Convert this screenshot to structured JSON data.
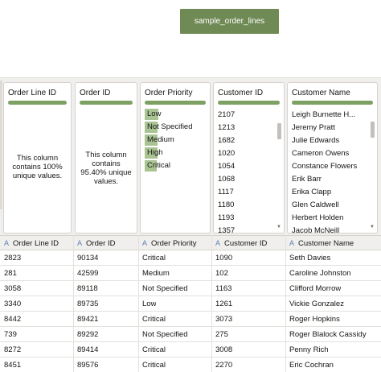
{
  "dataset": {
    "label": "sample_order_lines"
  },
  "cards": {
    "order_line_id": {
      "title": "Order Line ID",
      "message": "This column contains 100% unique values."
    },
    "order_id": {
      "title": "Order ID",
      "message": "This column contains 95.40% unique values."
    },
    "order_priority": {
      "title": "Order Priority",
      "items": [
        {
          "label": "Low",
          "share": 0.22
        },
        {
          "label": "Not Specified",
          "share": 0.2
        },
        {
          "label": "Medium",
          "share": 0.2
        },
        {
          "label": "High",
          "share": 0.2
        },
        {
          "label": "Critical",
          "share": 0.19
        }
      ]
    },
    "customer_id": {
      "title": "Customer ID",
      "values": [
        "2107",
        "1213",
        "1682",
        "1020",
        "1054",
        "1068",
        "1117",
        "1180",
        "1193",
        "1357"
      ]
    },
    "customer_name": {
      "title": "Customer Name",
      "values": [
        "Leigh Burnette H...",
        "Jeremy Pratt",
        "Julie Edwards",
        "Cameron Owens",
        "Constance Flowers",
        "Erik Barr",
        "Erika Clapp",
        "Glen Caldwell",
        "Herbert Holden",
        "Jacob McNeill"
      ]
    }
  },
  "grid": {
    "type_icon": "A",
    "columns": [
      "Order Line ID",
      "Order ID",
      "Order Priority",
      "Customer ID",
      "Customer Name"
    ],
    "rows": [
      [
        "2823",
        "90134",
        "Critical",
        "1090",
        "Seth Davies"
      ],
      [
        "281",
        "42599",
        "Medium",
        "102",
        "Caroline Johnston"
      ],
      [
        "3058",
        "89118",
        "Not Specified",
        "1163",
        "Clifford Morrow"
      ],
      [
        "3340",
        "89735",
        "Low",
        "1261",
        "Vickie Gonzalez"
      ],
      [
        "8442",
        "89421",
        "Critical",
        "3073",
        "Roger Hopkins"
      ],
      [
        "739",
        "89292",
        "Not Specified",
        "275",
        "Roger Blalock Cassidy"
      ],
      [
        "8272",
        "89414",
        "Critical",
        "3008",
        "Penny Rich"
      ],
      [
        "8451",
        "89576",
        "Critical",
        "2270",
        "Eric Cochran"
      ]
    ]
  }
}
